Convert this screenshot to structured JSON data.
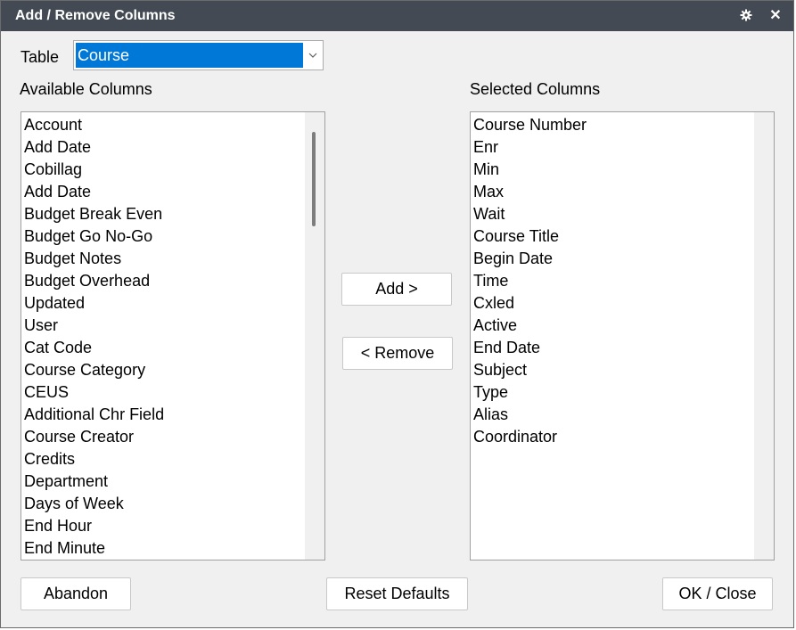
{
  "window": {
    "title": "Add / Remove Columns",
    "close_glyph": "✕",
    "settings_icon": "gear-icon"
  },
  "table": {
    "label": "Table",
    "selected": "Course"
  },
  "available": {
    "heading": "Available Columns",
    "items": [
      "Account",
      "Add Date",
      "Cobillag",
      "Add Date",
      "Budget Break Even",
      "Budget Go No-Go",
      "Budget Notes",
      "Budget Overhead",
      "Updated",
      "User",
      "Cat Code",
      "Course Category",
      "CEUS",
      "Additional Chr Field",
      "Course Creator",
      "Credits",
      "Department",
      "Days of Week",
      "End Hour",
      "End Minute"
    ]
  },
  "selected": {
    "heading": "Selected Columns",
    "items": [
      "Course Number",
      "Enr",
      "Min",
      "Max",
      "Wait",
      "Course Title",
      "Begin Date",
      "Time",
      "Cxled",
      "Active",
      "End Date",
      "Subject",
      "Type",
      "Alias",
      "Coordinator"
    ]
  },
  "buttons": {
    "add": "Add >",
    "remove": "< Remove",
    "abandon": "Abandon",
    "reset": "Reset Defaults",
    "ok": "OK / Close"
  },
  "colors": {
    "titlebar": "#434a54",
    "selection": "#0078d7"
  }
}
